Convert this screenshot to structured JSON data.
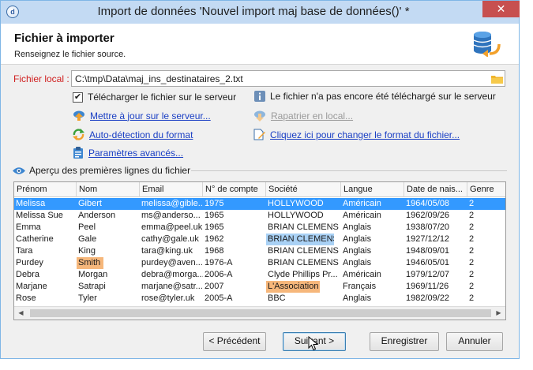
{
  "window": {
    "title": "Import de données 'Nouvel import maj base de données()' *",
    "close_label": "✕"
  },
  "header": {
    "title": "Fichier à importer",
    "subtitle": "Renseignez le fichier source."
  },
  "file": {
    "label": "Fichier local :",
    "value": "C:\\tmp\\Data\\maj_ins_destinataires_2.txt"
  },
  "options": {
    "upload_label": "Télécharger le fichier sur le serveur",
    "upload_checked": true,
    "checkmark": "✔",
    "info_text": "Le fichier n'a pas encore été téléchargé sur le serveur",
    "update_server": "Mettre à jour sur le serveur...",
    "fetch_local": "Rapatrier en local...",
    "auto_detect": "Auto-détection du format",
    "change_format": "Cliquez ici pour changer le format du fichier...",
    "advanced": "Paramètres avancés..."
  },
  "preview": {
    "title": "Aperçu des premières lignes du fichier",
    "columns": [
      "Prénom",
      "Nom",
      "Email",
      "N° de compte",
      "Société",
      "Langue",
      "Date de nais...",
      "Genre"
    ],
    "rows": [
      [
        "Melissa",
        "Gibert",
        "melissa@gible...",
        "1975",
        "HOLLYWOOD",
        "Américain",
        "1964/05/08",
        "2"
      ],
      [
        "Melissa Sue",
        "Anderson",
        "ms@anderso...",
        "1965",
        "HOLLYWOOD",
        "Américain",
        "1962/09/26",
        "2"
      ],
      [
        "Emma",
        "Peel",
        "emma@peel.uk",
        "1965",
        "BRIAN CLEMENS",
        "Anglais",
        "1938/07/20",
        "2"
      ],
      [
        "Catherine",
        "Gale",
        "cathy@gale.uk",
        "1962",
        "BRIAN CLEMENS",
        "Anglais",
        "1927/12/12",
        "2"
      ],
      [
        "Tara",
        "King",
        "tara@king.uk",
        "1968",
        "BRIAN CLEMENS",
        "Anglais",
        "1948/09/01",
        "2"
      ],
      [
        "Purdey",
        "Smith",
        "purdey@aven...",
        "1976-A",
        "BRIAN CLEMENS",
        "Anglais",
        "1946/05/01",
        "2"
      ],
      [
        "Debra",
        "Morgan",
        "debra@morga...",
        "2006-A",
        "Clyde Phillips Pr...",
        "Américain",
        "1979/12/07",
        "2"
      ],
      [
        "Marjane",
        "Satrapi",
        "marjane@satr...",
        "2007",
        "L'Association",
        "Français",
        "1969/11/26",
        "2"
      ],
      [
        "Rose",
        "Tyler",
        "rose@tyler.uk",
        "2005-A",
        "BBC",
        "Anglais",
        "1982/09/22",
        "2"
      ]
    ],
    "scroll_left": "◀",
    "scroll_right": "▶"
  },
  "buttons": {
    "previous": "< Précédent",
    "next": "Suivant >",
    "save": "Enregistrer",
    "cancel": "Annuler"
  },
  "colors": {
    "selection": "#3399ff",
    "highlight_orange": "#f6b77b",
    "highlight_blue": "#a9d1f5",
    "link": "#1a3fc4",
    "required_label": "#d02020"
  }
}
